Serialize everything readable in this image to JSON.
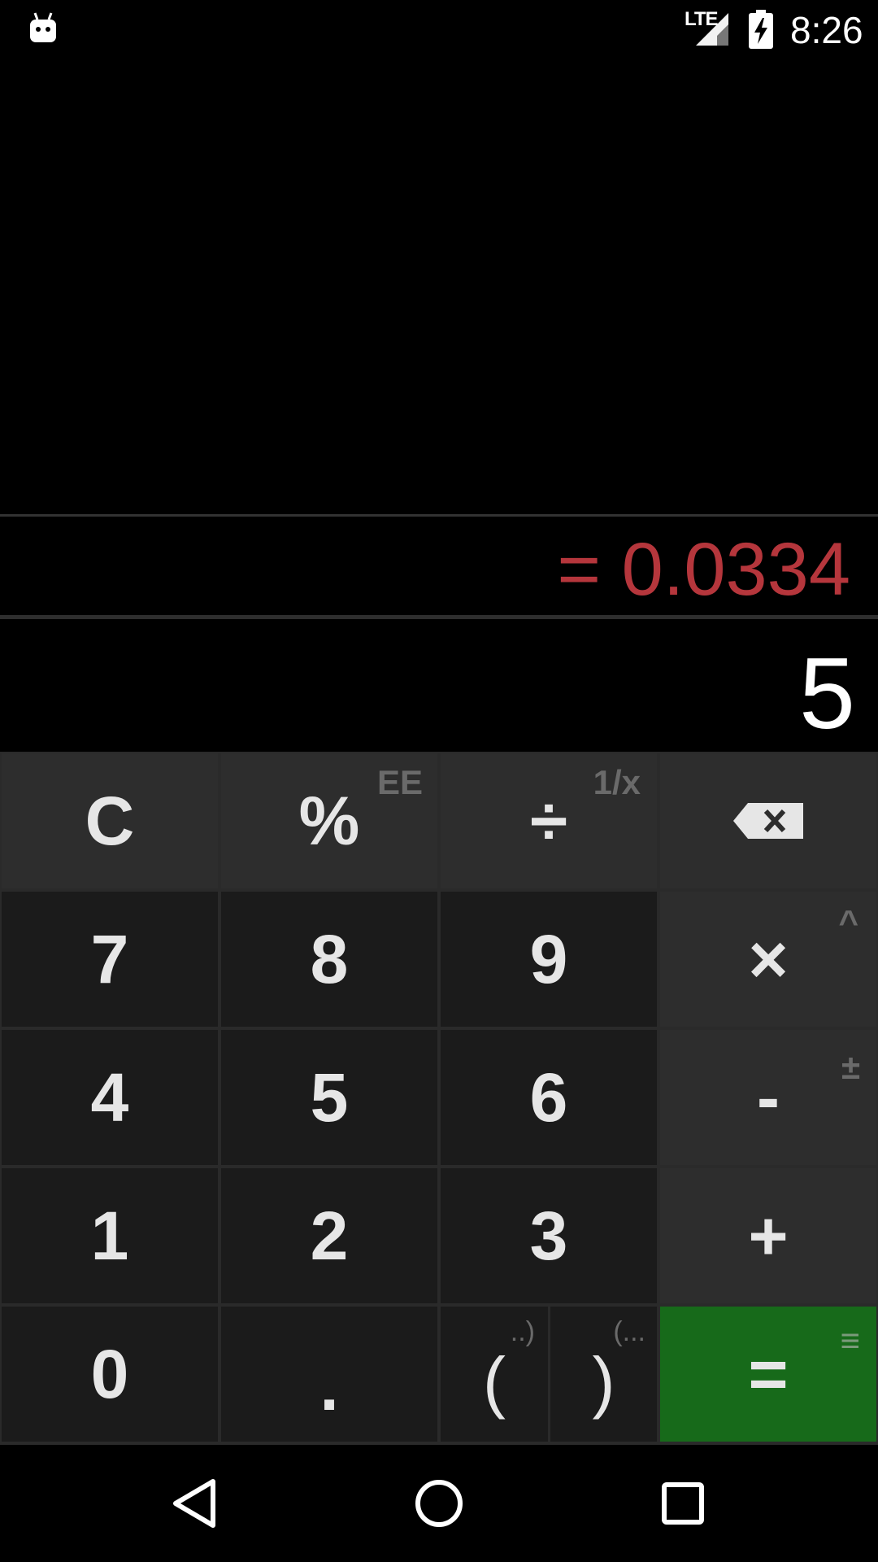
{
  "status_bar": {
    "network": "LTE",
    "time": "8:26",
    "icons": [
      "android-notification-icon",
      "signal-icon",
      "battery-charging-icon"
    ]
  },
  "display": {
    "result": "= 0.0334",
    "formula": "5",
    "result_color": "#b5363c"
  },
  "keypad": {
    "rows": [
      [
        {
          "label": "C",
          "sub": ""
        },
        {
          "label": "%",
          "sub": "EE"
        },
        {
          "label": "÷",
          "sub": "1/x"
        },
        {
          "label": "⌫",
          "sub": "",
          "icon": "backspace-icon"
        }
      ],
      [
        {
          "label": "7"
        },
        {
          "label": "8"
        },
        {
          "label": "9"
        },
        {
          "label": "×",
          "sub": "^"
        }
      ],
      [
        {
          "label": "4"
        },
        {
          "label": "5"
        },
        {
          "label": "6"
        },
        {
          "label": "-",
          "sub": "±"
        }
      ],
      [
        {
          "label": "1"
        },
        {
          "label": "2"
        },
        {
          "label": "3"
        },
        {
          "label": "+"
        }
      ],
      [
        {
          "label": "0"
        },
        {
          "label": "."
        },
        {
          "label": "(",
          "sub": "..)"
        },
        {
          "label": ")",
          "sub": "(..."
        },
        {
          "label": "=",
          "sub": "≡"
        }
      ]
    ],
    "colors": {
      "digit_key": "#1b1b1b",
      "operator_key": "#2d2d2d",
      "equals_key": "#176a1a"
    }
  },
  "nav_bar": {
    "icons": [
      "back-icon",
      "home-icon",
      "recents-icon"
    ]
  }
}
